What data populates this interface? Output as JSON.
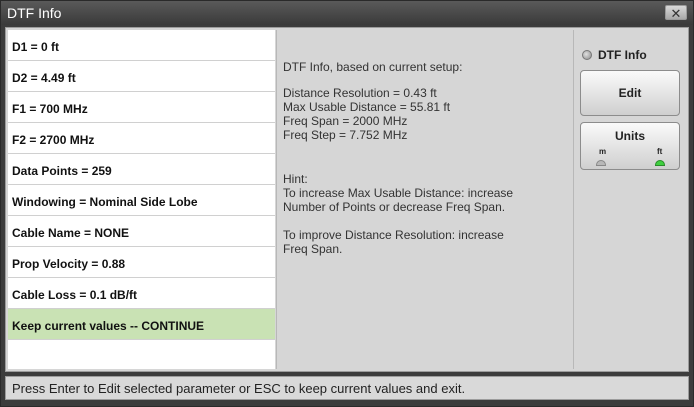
{
  "window": {
    "title": "DTF Info",
    "close_glyph": "✕"
  },
  "parameters": [
    {
      "label": "D1 = 0 ft"
    },
    {
      "label": "D2 = 4.49 ft"
    },
    {
      "label": "F1 = 700 MHz"
    },
    {
      "label": "F2 = 2700 MHz"
    },
    {
      "label": "Data Points = 259"
    },
    {
      "label": "Windowing = Nominal Side Lobe"
    },
    {
      "label": "Cable Name = NONE"
    },
    {
      "label": "Prop Velocity = 0.88"
    },
    {
      "label": "Cable Loss = 0.1 dB/ft"
    },
    {
      "label": "Keep current values -- CONTINUE"
    }
  ],
  "info": {
    "heading": "DTF Info, based on current setup:",
    "distance_resolution": "Distance Resolution = 0.43 ft",
    "max_usable_distance": "Max Usable Distance = 55.81 ft",
    "freq_span": "Freq Span = 2000 MHz",
    "freq_step": "Freq Step = 7.752 MHz",
    "hint_title": "Hint:",
    "hint_1_line1": "To increase Max Usable Distance: increase",
    "hint_1_line2": "Number of Points or decrease Freq Span.",
    "hint_2_line1": "To improve Distance Resolution: increase",
    "hint_2_line2": "Freq Span."
  },
  "side": {
    "radio_label": "DTF Info",
    "edit_label": "Edit",
    "units_label": "Units",
    "units_left": "m",
    "units_right": "ft",
    "units_selected": "ft"
  },
  "status": "Press Enter to Edit selected parameter or ESC to keep current values and exit.",
  "colors": {
    "selected_row": "#c9e2b4",
    "units_led_on": "#3fcf3f"
  }
}
